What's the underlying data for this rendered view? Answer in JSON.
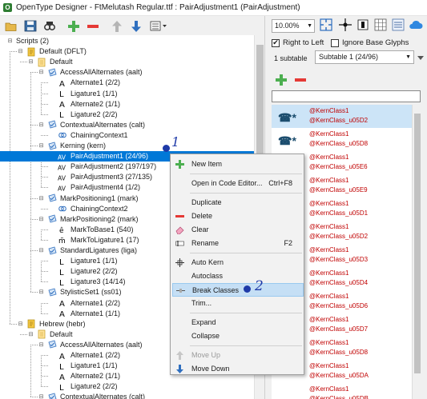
{
  "window": {
    "title": "OpenType Designer - FtMelutash Regular.ttf : PairAdjustment1 (PairAdjustment)"
  },
  "toolbar": {
    "buttons": [
      "open-folder",
      "save",
      "search",
      "add",
      "remove",
      "move-up",
      "move-down",
      "more"
    ]
  },
  "tree": {
    "rows": [
      {
        "label": "Scripts (2)",
        "depth": 0,
        "icon": "none",
        "expander": "minus"
      },
      {
        "label": "Default (DFLT)",
        "depth": 1,
        "icon": "script-icon",
        "expander": "minus"
      },
      {
        "label": "Default",
        "depth": 2,
        "icon": "language-icon",
        "expander": "minus"
      },
      {
        "label": "AccessAllAlternates (aalt)",
        "depth": 3,
        "icon": "feature-icon",
        "expander": "minus"
      },
      {
        "label": "Alternate1 (2/2)",
        "depth": 4,
        "icon": "lookup-a-icon",
        "expander": ""
      },
      {
        "label": "Ligature1 (1/1)",
        "depth": 4,
        "icon": "lookup-l-icon",
        "expander": ""
      },
      {
        "label": "Alternate2 (1/1)",
        "depth": 4,
        "icon": "lookup-a-icon",
        "expander": ""
      },
      {
        "label": "Ligature2 (2/2)",
        "depth": 4,
        "icon": "lookup-l-icon",
        "expander": ""
      },
      {
        "label": "ContextualAlternates (calt)",
        "depth": 3,
        "icon": "feature-icon",
        "expander": "minus"
      },
      {
        "label": "ChainingContext1",
        "depth": 4,
        "icon": "chaining-icon",
        "expander": ""
      },
      {
        "label": "Kerning (kern)",
        "depth": 3,
        "icon": "feature-icon",
        "expander": "minus"
      },
      {
        "label": "PairAdjustment1 (24/96)",
        "depth": 4,
        "icon": "lookup-av-icon",
        "expander": "",
        "selected": true
      },
      {
        "label": "PairAdjustment2 (197/197)",
        "depth": 4,
        "icon": "lookup-av-icon",
        "expander": ""
      },
      {
        "label": "PairAdjustment3 (27/135)",
        "depth": 4,
        "icon": "lookup-av-icon",
        "expander": ""
      },
      {
        "label": "PairAdjustment4 (1/2)",
        "depth": 4,
        "icon": "lookup-av-icon",
        "expander": ""
      },
      {
        "label": "MarkPositioning1 (mark)",
        "depth": 3,
        "icon": "feature-icon",
        "expander": "minus"
      },
      {
        "label": "ChainingContext2",
        "depth": 4,
        "icon": "chaining-icon",
        "expander": ""
      },
      {
        "label": "MarkPositioning2 (mark)",
        "depth": 3,
        "icon": "feature-icon",
        "expander": "minus"
      },
      {
        "label": "MarkToBase1 (540)",
        "depth": 4,
        "icon": "lookup-e-icon",
        "expander": ""
      },
      {
        "label": "MarkToLigature1 (17)",
        "depth": 4,
        "icon": "lookup-m-icon",
        "expander": ""
      },
      {
        "label": "StandardLigatures (liga)",
        "depth": 3,
        "icon": "feature-icon",
        "expander": "minus"
      },
      {
        "label": "Ligature1 (1/1)",
        "depth": 4,
        "icon": "lookup-l-icon",
        "expander": ""
      },
      {
        "label": "Ligature2 (2/2)",
        "depth": 4,
        "icon": "lookup-l-icon",
        "expander": ""
      },
      {
        "label": "Ligature3 (14/14)",
        "depth": 4,
        "icon": "lookup-l-icon",
        "expander": ""
      },
      {
        "label": "StylisticSet1 (ss01)",
        "depth": 3,
        "icon": "feature-icon",
        "expander": "minus"
      },
      {
        "label": "Alternate1 (2/2)",
        "depth": 4,
        "icon": "lookup-a-icon",
        "expander": ""
      },
      {
        "label": "Alternate1 (1/1)",
        "depth": 4,
        "icon": "lookup-a-icon",
        "expander": ""
      },
      {
        "label": "Hebrew (hebr)",
        "depth": 1,
        "icon": "script-icon",
        "expander": "minus"
      },
      {
        "label": "Default",
        "depth": 2,
        "icon": "language-icon",
        "expander": "minus"
      },
      {
        "label": "AccessAllAlternates (aalt)",
        "depth": 3,
        "icon": "feature-icon",
        "expander": "minus"
      },
      {
        "label": "Alternate1 (2/2)",
        "depth": 4,
        "icon": "lookup-a-icon",
        "expander": ""
      },
      {
        "label": "Ligature1 (1/1)",
        "depth": 4,
        "icon": "lookup-l-icon",
        "expander": ""
      },
      {
        "label": "Alternate2 (1/1)",
        "depth": 4,
        "icon": "lookup-a-icon",
        "expander": ""
      },
      {
        "label": "Ligature2 (2/2)",
        "depth": 4,
        "icon": "lookup-l-icon",
        "expander": ""
      },
      {
        "label": "ContextualAlternates (calt)",
        "depth": 3,
        "icon": "feature-icon",
        "expander": "minus"
      }
    ]
  },
  "right": {
    "zoom": "10.00%",
    "right_to_left": {
      "label": "Right to Left",
      "checked": true
    },
    "ignore_base_glyphs": {
      "label": "Ignore Base Glyphs",
      "checked": false
    },
    "subtable_count": "1 subtable",
    "subtable_selected": "Subtable 1 (24/96)",
    "filter_value": "",
    "kern_rows": [
      {
        "glyph": "☎*",
        "class1": "@KernClass1",
        "class2": "@KernClass_u05D2",
        "selected": true
      },
      {
        "glyph": "☎*",
        "class1": "@KernClass1",
        "class2": "@KernClass_u05D8"
      },
      {
        "glyph": "",
        "class1": "@KernClass1",
        "class2": "@KernClass_u05E6"
      },
      {
        "glyph": "",
        "class1": "@KernClass1",
        "class2": "@KernClass_u05E9"
      },
      {
        "glyph": "",
        "class1": "@KernClass1",
        "class2": "@KernClass_u05D1"
      },
      {
        "glyph": "",
        "class1": "@KernClass1",
        "class2": "@KernClass_u05D2"
      },
      {
        "glyph": "",
        "class1": "@KernClass1",
        "class2": "@KernClass_u05D3"
      },
      {
        "glyph": "",
        "class1": "@KernClass1",
        "class2": "@KernClass_u05D4"
      },
      {
        "glyph": "",
        "class1": "@KernClass1",
        "class2": "@KernClass_u05D6"
      },
      {
        "glyph": "",
        "class1": "@KernClass1",
        "class2": "@KernClass_u05D7"
      },
      {
        "glyph": "",
        "class1": "@KernClass1",
        "class2": "@KernClass_u05D8"
      },
      {
        "glyph": "",
        "class1": "@KernClass1",
        "class2": "@KernClass_u05DA"
      },
      {
        "glyph": "",
        "class1": "@KernClass1",
        "class2": "@KernClass_u05DB"
      }
    ]
  },
  "context_menu": {
    "items": [
      {
        "label": "New Item",
        "shortcut": "",
        "icon": "plus-icon",
        "state": "normal"
      },
      {
        "sep": true
      },
      {
        "label": "Open in Code Editor...",
        "shortcut": "Ctrl+F8",
        "icon": "",
        "state": "normal"
      },
      {
        "sep": true
      },
      {
        "label": "Duplicate",
        "shortcut": "",
        "icon": "",
        "state": "normal"
      },
      {
        "label": "Delete",
        "shortcut": "",
        "icon": "minus-icon",
        "state": "normal"
      },
      {
        "label": "Clear",
        "shortcut": "",
        "icon": "eraser-icon",
        "state": "normal"
      },
      {
        "label": "Rename",
        "shortcut": "F2",
        "icon": "rename-icon",
        "state": "normal"
      },
      {
        "sep": true
      },
      {
        "label": "Auto Kern",
        "shortcut": "",
        "icon": "autokern-icon",
        "state": "normal"
      },
      {
        "label": "Autoclass",
        "shortcut": "",
        "icon": "",
        "state": "normal"
      },
      {
        "label": "Break Classes",
        "shortcut": "",
        "icon": "break-icon",
        "state": "highlighted"
      },
      {
        "label": "Trim...",
        "shortcut": "",
        "icon": "",
        "state": "normal"
      },
      {
        "sep": true
      },
      {
        "label": "Expand",
        "shortcut": "",
        "icon": "",
        "state": "normal"
      },
      {
        "label": "Collapse",
        "shortcut": "",
        "icon": "",
        "state": "normal"
      },
      {
        "sep": true
      },
      {
        "label": "Move Up",
        "shortcut": "",
        "icon": "arrow-up-icon",
        "state": "disabled"
      },
      {
        "label": "Move Down",
        "shortcut": "",
        "icon": "arrow-down-icon",
        "state": "normal"
      }
    ]
  },
  "annotations": {
    "step1": "1",
    "step2": "2"
  },
  "colors": {
    "selection": "#0078d7",
    "kern_class": "#c00000",
    "annotation": "#1f3aa8",
    "plus_green": "#4caf50",
    "minus_red": "#e53935"
  }
}
